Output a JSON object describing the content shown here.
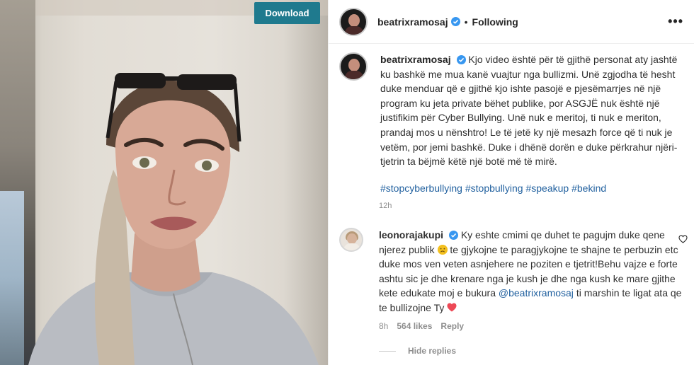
{
  "media": {
    "download_label": "Download"
  },
  "post": {
    "username": "beatrixramosaj",
    "separator": "•",
    "follow_status": "Following",
    "more_label": "•••",
    "caption": "Kjo video është për të gjithë personat aty jashtë ku bashkë me mua kanë vuajtur nga bullizmi. Unë zgjodha të hesht duke menduar që e gjithë kjo ishte pasojë e pjesëmarrjes në një program ku jeta private bëhet publike, por ASGJË nuk është një justifikim për Cyber Bullying. Unë nuk e meritoj, ti nuk e meriton, prandaj mos u nënshtro! Le të jetë ky një mesazh force që ti nuk je vetëm, por jemi bashkë. Duke i dhënë dorën e duke përkrahur njëri-tjetrin ta bëjmë këtë një botë më të mirë.",
    "hashtags": [
      "#stopcyberbullying",
      "#stopbullying",
      "#speakup",
      "#bekind"
    ],
    "time": "12h"
  },
  "comment": {
    "username": "leonorajakupi",
    "text_part1": "Ky eshte cmimi qe duhet te pagujm duke qene njerez publik",
    "text_part2": "te gjykojne te paragjykojne te shajne te perbuzin etc duke mos ven veten asnjehere ne poziten e tjetrit!Behu vajze e forte ashtu sic je dhe krenare nga je kush je dhe nga kush ke mare gjithe kete edukate moj e bukura",
    "mention": "@beatrixramosaj",
    "text_part3": "ti marshin te ligat ata qe te bullizojne Ty",
    "time": "8h",
    "likes": "564 likes",
    "reply_label": "Reply",
    "hide_replies_label": "Hide replies"
  },
  "colors": {
    "download_bg": "#1f7a8e",
    "link": "#1f5f9e",
    "verified": "#3897f0",
    "heart": "#ed4956"
  }
}
